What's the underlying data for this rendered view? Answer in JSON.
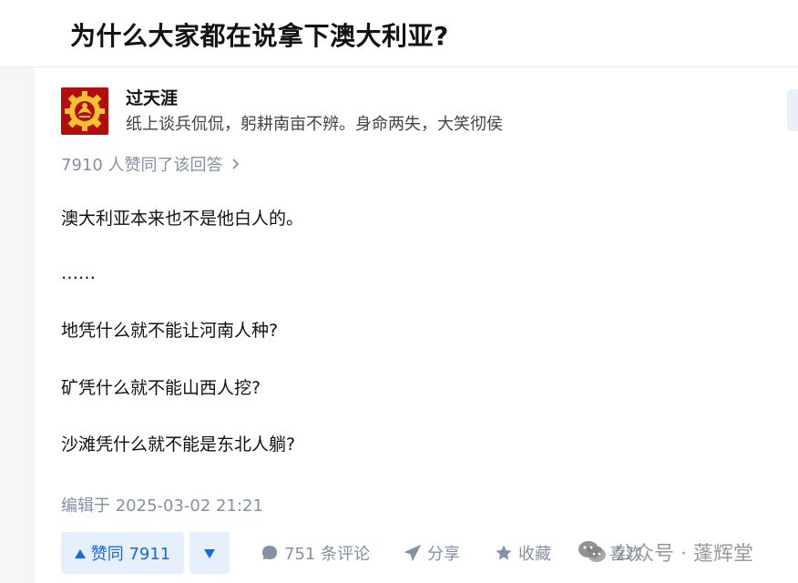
{
  "question": {
    "title": "为什么大家都在说拿下澳大利亚?"
  },
  "author": {
    "name": "过天涯",
    "bio": "纸上谈兵侃侃，躬耕南亩不辨。身命两失，大笑彻侯"
  },
  "vote_info": "7910 人赞同了该回答",
  "answer": {
    "paragraphs": [
      "澳大利亚本来也不是他白人的。",
      "……",
      "地凭什么就不能让河南人种?",
      "矿凭什么就不能山西人挖?",
      "沙滩凭什么就不能是东北人躺?"
    ],
    "edited": "编辑于 2025-03-02 21:21"
  },
  "actions": {
    "upvote_label": "赞同 7911",
    "comments_label": "751 条评论",
    "share_label": "分享",
    "collect_label": "收藏",
    "like_label": "喜欢"
  },
  "watermark": {
    "text": "公众号 · 蓬辉堂"
  },
  "colors": {
    "accent": "#1768e8",
    "accent_bg": "#e6effc",
    "muted": "#8590a6"
  },
  "icons": {
    "upvote": "triangle-up-icon",
    "downvote": "triangle-down-icon",
    "comment": "comment-bubble-icon",
    "share": "paper-plane-icon",
    "collect": "star-icon"
  }
}
